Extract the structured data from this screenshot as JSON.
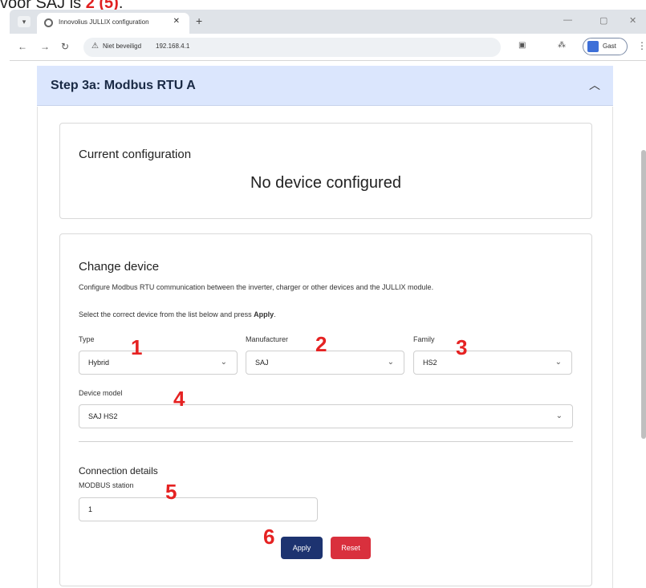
{
  "caption": {
    "text": "voor SAJ is ",
    "emphasis": "2 (5)",
    "end": "."
  },
  "browser": {
    "tab_title": "Innovolius JULLIX configuration",
    "tab_close": "✕",
    "new_tab": "+",
    "security_label": "Niet beveiligd",
    "url": "192.168.4.1",
    "guest_label": "Gast"
  },
  "step": {
    "title": "Step 3a: Modbus RTU A"
  },
  "current_config": {
    "heading": "Current configuration",
    "status": "No device configured"
  },
  "change_device": {
    "heading": "Change device",
    "description": "Configure Modbus RTU communication between the inverter, charger or other devices and the JULLIX module.",
    "instruction_prefix": "Select the correct device from the list below and press ",
    "instruction_bold": "Apply",
    "instruction_suffix": ".",
    "type": {
      "label": "Type",
      "value": "Hybrid"
    },
    "manufacturer": {
      "label": "Manufacturer",
      "value": "SAJ"
    },
    "family": {
      "label": "Family",
      "value": "HS2"
    },
    "model": {
      "label": "Device model",
      "value": "SAJ HS2"
    },
    "connection_heading": "Connection details",
    "station": {
      "label": "MODBUS station",
      "value": "1"
    },
    "apply_label": "Apply",
    "reset_label": "Reset"
  },
  "annotations": [
    "1",
    "2",
    "3",
    "4",
    "5",
    "6"
  ],
  "colors": {
    "header_bg": "#dbe6fd",
    "apply": "#1d3370",
    "reset": "#d9303d",
    "annotation": "#e52222"
  }
}
